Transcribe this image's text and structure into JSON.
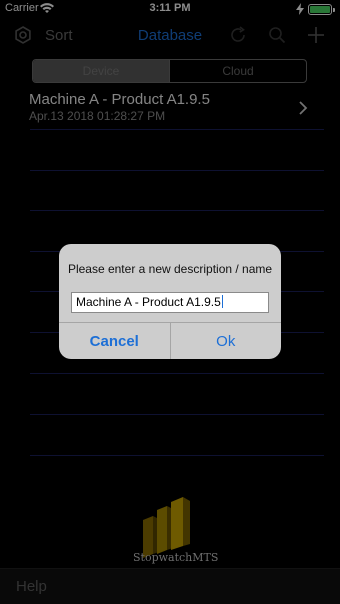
{
  "status_bar": {
    "carrier": "Carrier",
    "time": "3:11 PM",
    "battery_color": "#4cd964"
  },
  "nav": {
    "sort_label": "Sort",
    "title": "Database"
  },
  "segmented": {
    "items": [
      "Device",
      "Cloud"
    ],
    "selected": "Device"
  },
  "list": [
    {
      "name": "Machine A - Product A1.9.5",
      "date": "Apr.13 2018 01:28:27 PM"
    }
  ],
  "logo_text": "StopwatchMTS",
  "bottom": {
    "help_label": "Help"
  },
  "alert": {
    "message": "Please enter a new description / name",
    "field_value": "Machine A - Product A1.9.5",
    "cancel_label": "Cancel",
    "ok_label": "Ok"
  },
  "colors": {
    "accent": "#1d6fd6",
    "background": "#000000",
    "separator": "#1a1f5a"
  }
}
